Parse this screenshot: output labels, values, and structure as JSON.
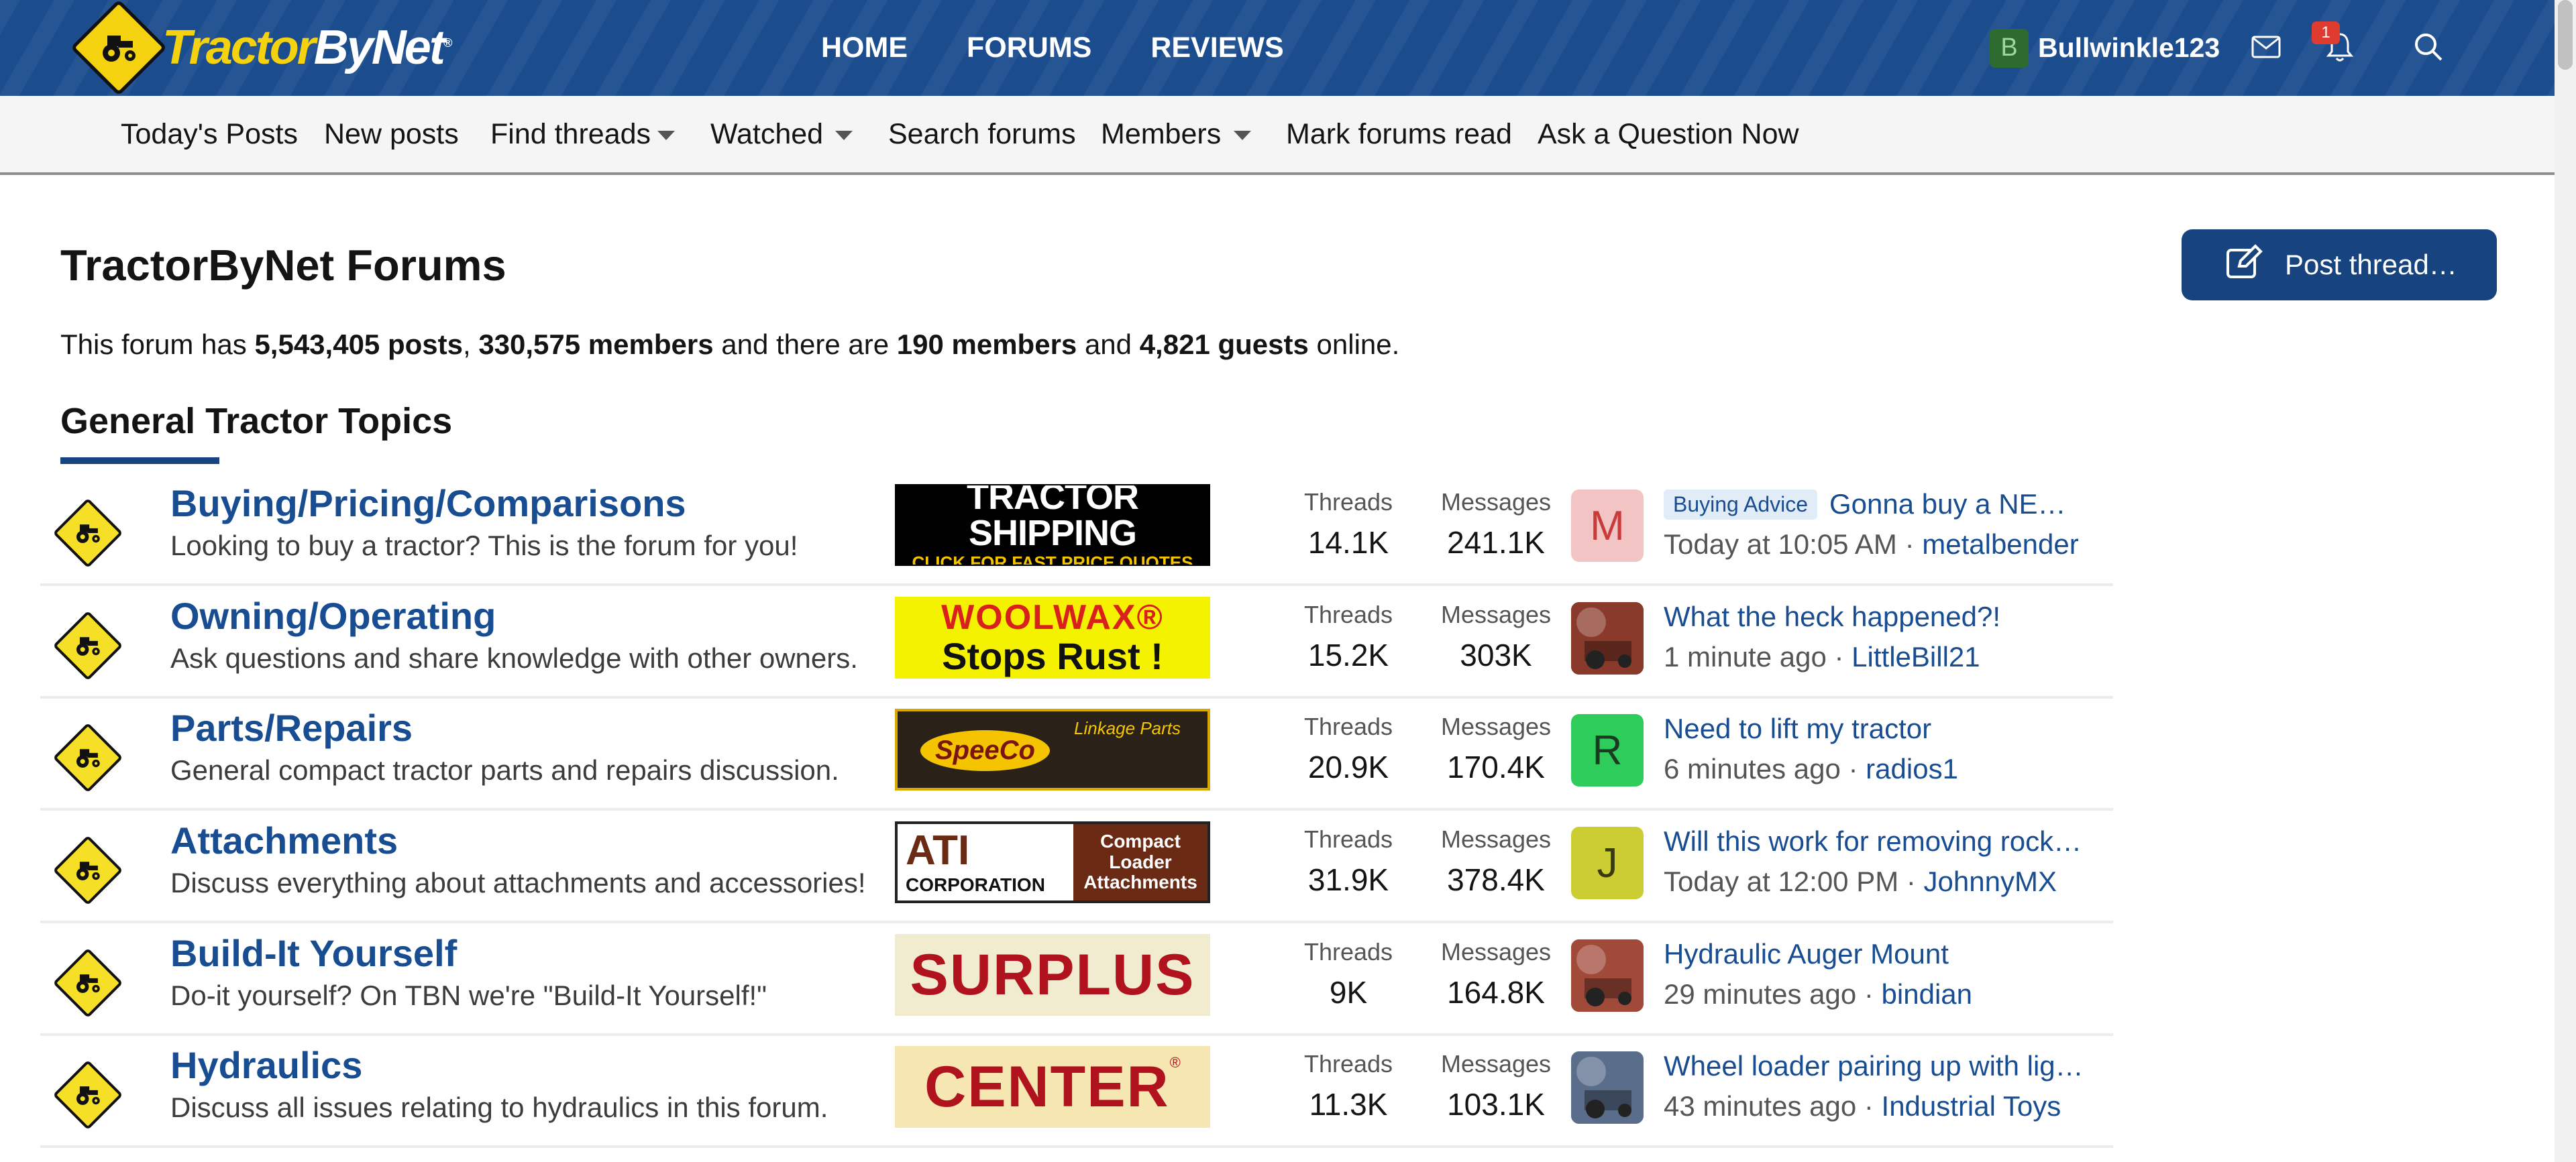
{
  "header": {
    "logo_tractor": "Tractor",
    "logo_by": "By",
    "logo_net": "Net",
    "logo_reg": "®",
    "nav": [
      "HOME",
      "FORUMS",
      "REVIEWS"
    ],
    "user": {
      "initial": "B",
      "name": "Bullwinkle123"
    },
    "alerts_count": "1"
  },
  "subnav": {
    "items": [
      "Today's Posts",
      "New posts",
      "Find threads",
      "Watched",
      "Search forums",
      "Members",
      "Mark forums read",
      "Ask a Question Now"
    ]
  },
  "page": {
    "title": "TractorByNet Forums",
    "post_thread_label": "Post thread…",
    "stats": {
      "prefix": "This forum has ",
      "posts": "5,543,405 posts",
      "sep1": ", ",
      "members": "330,575 members",
      "mid": " and there are ",
      "online_members": "190 members",
      "and": " and ",
      "guests": "4,821 guests",
      "suffix": " online."
    },
    "section_title": "General Tractor Topics"
  },
  "forums": [
    {
      "name": "Buying/Pricing/Comparisons",
      "desc": "Looking to buy a tractor? This is the forum for you!",
      "ad": {
        "line1": "TRACTOR SHIPPING",
        "line2": "CLICK FOR FAST PRICE QUOTES"
      },
      "threads_label": "Threads",
      "threads": "14.1K",
      "messages_label": "Messages",
      "messages": "241.1K",
      "avatar": {
        "type": "letter",
        "letter": "M",
        "bg": "#f2c4c4",
        "fg": "#c93a3a"
      },
      "prefix": "Buying Advice",
      "last_thread": "Gonna buy a NE…",
      "last_time": "Today at 10:05 AM",
      "last_user": "metalbender"
    },
    {
      "name": "Owning/Operating",
      "desc": "Ask questions and share knowledge with other owners.",
      "ad": {
        "line1": "WOOLWAX®",
        "line2": "Stops Rust !"
      },
      "threads_label": "Threads",
      "threads": "15.2K",
      "messages_label": "Messages",
      "messages": "303K",
      "avatar": {
        "type": "photo",
        "bg": "#8a3a2a"
      },
      "prefix": "",
      "last_thread": "What the heck happened?!",
      "last_time": "1 minute ago",
      "last_user": "LittleBill21"
    },
    {
      "name": "Parts/Repairs",
      "desc": "General compact tractor parts and repairs discussion.",
      "ad": {
        "line1": "SpeeCo",
        "line2": "Linkage Parts"
      },
      "threads_label": "Threads",
      "threads": "20.9K",
      "messages_label": "Messages",
      "messages": "170.4K",
      "avatar": {
        "type": "letter",
        "letter": "R",
        "bg": "#2ecc5a",
        "fg": "#1a3a22"
      },
      "prefix": "",
      "last_thread": "Need to lift my tractor",
      "last_time": "6 minutes ago",
      "last_user": "radios1"
    },
    {
      "name": "Attachments",
      "desc": "Discuss everything about attachments and accessories!",
      "ad": {
        "line1": "ATI",
        "line2": "CORPORATION",
        "line3": "Compact Loader Attachments"
      },
      "threads_label": "Threads",
      "threads": "31.9K",
      "messages_label": "Messages",
      "messages": "378.4K",
      "avatar": {
        "type": "letter",
        "letter": "J",
        "bg": "#cccc33",
        "fg": "#3a3a10"
      },
      "prefix": "",
      "last_thread": "Will this work for removing rock…",
      "last_time": "Today at 12:00 PM",
      "last_user": "JohnnyMX"
    },
    {
      "name": "Build-It Yourself",
      "desc": "Do-it yourself? On TBN we're \"Build-It Yourself!\"",
      "ad": {
        "line1": "SURPLUS"
      },
      "threads_label": "Threads",
      "threads": "9K",
      "messages_label": "Messages",
      "messages": "164.8K",
      "avatar": {
        "type": "photo",
        "bg": "#a24a3a"
      },
      "prefix": "",
      "last_thread": "Hydraulic Auger Mount",
      "last_time": "29 minutes ago",
      "last_user": "bindian"
    },
    {
      "name": "Hydraulics",
      "desc": "Discuss all issues relating to hydraulics in this forum.",
      "ad": {
        "line1": "CENTER",
        "line2": "®"
      },
      "threads_label": "Threads",
      "threads": "11.3K",
      "messages_label": "Messages",
      "messages": "103.1K",
      "avatar": {
        "type": "photo",
        "bg": "#5a6e8c"
      },
      "prefix": "",
      "last_thread": "Wheel loader pairing up with lig…",
      "last_time": "43 minutes ago",
      "last_user": "Industrial Toys"
    }
  ],
  "colors": {
    "header_blue": "#1b4c8e",
    "link_blue": "#184d92",
    "button_blue": "#17437f",
    "logo_yellow": "#f5d20f"
  },
  "icons": [
    "tractor-logo-icon",
    "mail-icon",
    "bell-icon",
    "search-icon",
    "edit-icon",
    "forum-tractor-icon"
  ]
}
